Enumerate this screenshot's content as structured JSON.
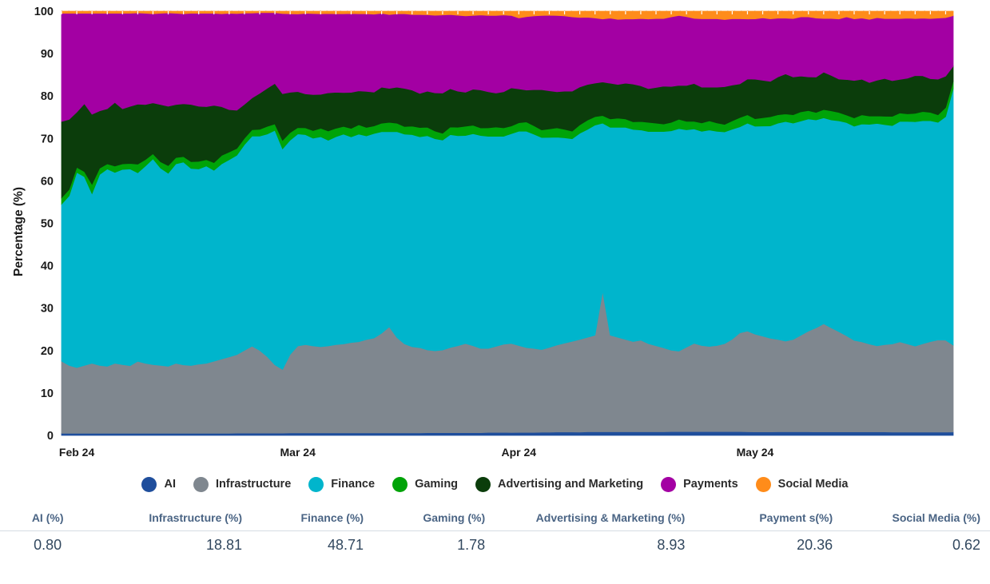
{
  "chart_data": {
    "type": "area",
    "stacked": true,
    "stack_mode": "percent",
    "title": "",
    "xlabel": "",
    "ylabel": "Percentage (%)",
    "ylim": [
      0,
      100
    ],
    "yticks": [
      0,
      10,
      20,
      30,
      40,
      50,
      60,
      70,
      80,
      90,
      100
    ],
    "ytick_labels": [
      "0",
      "10",
      "20",
      "30",
      "40",
      "50",
      "60",
      "70",
      "80",
      "90",
      "100"
    ],
    "grid": true,
    "grid_style": "dotted",
    "legend_position": "bottom",
    "xtick_labels": [
      "Feb 24",
      "Mar 24",
      "Apr 24",
      "May 24"
    ],
    "xtick_positions": [
      2,
      31,
      60,
      91
    ],
    "x_count": 118,
    "series": [
      {
        "name": "AI",
        "color": "#1f4e9c",
        "values": [
          0.5,
          0.5,
          0.5,
          0.5,
          0.5,
          0.5,
          0.5,
          0.5,
          0.5,
          0.5,
          0.5,
          0.5,
          0.5,
          0.5,
          0.5,
          0.5,
          0.5,
          0.5,
          0.5,
          0.5,
          0.5,
          0.5,
          0.5,
          0.55,
          0.55,
          0.55,
          0.55,
          0.55,
          0.55,
          0.55,
          0.6,
          0.6,
          0.6,
          0.6,
          0.6,
          0.6,
          0.6,
          0.6,
          0.6,
          0.6,
          0.6,
          0.6,
          0.6,
          0.6,
          0.6,
          0.6,
          0.6,
          0.6,
          0.65,
          0.65,
          0.65,
          0.65,
          0.65,
          0.65,
          0.65,
          0.65,
          0.7,
          0.7,
          0.7,
          0.7,
          0.7,
          0.7,
          0.7,
          0.75,
          0.75,
          0.8,
          0.8,
          0.8,
          0.8,
          0.85,
          0.85,
          0.85,
          0.85,
          0.85,
          0.85,
          0.85,
          0.85,
          0.85,
          0.85,
          0.85,
          0.9,
          0.9,
          0.9,
          0.9,
          0.9,
          0.9,
          0.9,
          0.9,
          0.9,
          0.9,
          0.85,
          0.85,
          0.85,
          0.85,
          0.85,
          0.85,
          0.85,
          0.85,
          0.85,
          0.85,
          0.85,
          0.85,
          0.85,
          0.85,
          0.85,
          0.85,
          0.85,
          0.85,
          0.85,
          0.8,
          0.8,
          0.8,
          0.8,
          0.8,
          0.8,
          0.8,
          0.8,
          0.8
        ]
      },
      {
        "name": "Infrastructure",
        "color": "#7f878f",
        "values": [
          17.0,
          16.0,
          15.5,
          16.0,
          16.5,
          16.0,
          15.8,
          16.5,
          16.2,
          16.0,
          16.8,
          16.5,
          16.2,
          16.0,
          15.8,
          16.5,
          16.2,
          16.0,
          16.3,
          16.5,
          17.0,
          17.5,
          18.0,
          18.5,
          19.5,
          20.5,
          19.5,
          18.0,
          16.0,
          15.0,
          18.5,
          20.5,
          20.8,
          20.5,
          20.3,
          20.5,
          20.8,
          21.0,
          21.3,
          21.5,
          22.0,
          22.5,
          23.5,
          25.0,
          22.5,
          21.0,
          20.3,
          20.0,
          19.5,
          19.3,
          19.5,
          20.0,
          20.5,
          21.0,
          20.5,
          20.0,
          19.8,
          20.3,
          20.8,
          21.0,
          20.5,
          20.0,
          19.8,
          19.5,
          20.0,
          20.5,
          21.0,
          21.5,
          22.0,
          22.5,
          23.0,
          33.5,
          23.0,
          22.5,
          22.0,
          21.5,
          21.8,
          21.0,
          20.5,
          20.0,
          19.3,
          19.0,
          20.0,
          21.0,
          20.5,
          20.3,
          20.5,
          21.0,
          22.0,
          23.5,
          24.0,
          23.5,
          23.0,
          22.5,
          22.0,
          21.5,
          22.0,
          23.0,
          24.0,
          25.0,
          26.0,
          25.0,
          24.0,
          23.0,
          22.0,
          21.5,
          21.0,
          20.5,
          20.8,
          21.0,
          21.5,
          21.0,
          20.5,
          21.0,
          21.5,
          22.0,
          22.0,
          20.5
        ]
      },
      {
        "name": "Finance",
        "color": "#00b5cc",
        "values": [
          37.0,
          40.0,
          46.0,
          44.5,
          40.0,
          45.0,
          46.5,
          45.0,
          46.0,
          46.5,
          44.0,
          46.5,
          48.5,
          46.5,
          45.5,
          47.0,
          48.0,
          46.5,
          46.0,
          46.5,
          45.0,
          46.0,
          46.5,
          47.0,
          48.5,
          49.5,
          50.5,
          52.5,
          55.0,
          52.0,
          50.5,
          50.0,
          49.5,
          49.0,
          49.5,
          48.5,
          49.0,
          49.5,
          48.5,
          49.0,
          48.0,
          48.5,
          47.5,
          46.0,
          48.5,
          49.5,
          50.0,
          49.5,
          50.5,
          50.0,
          49.5,
          50.0,
          49.5,
          49.0,
          50.0,
          50.5,
          50.0,
          49.5,
          49.0,
          49.5,
          50.5,
          51.0,
          50.5,
          50.0,
          49.5,
          49.0,
          48.5,
          48.0,
          49.0,
          49.5,
          50.0,
          40.0,
          49.5,
          50.0,
          50.5,
          50.5,
          50.0,
          50.5,
          51.0,
          51.5,
          52.0,
          52.5,
          51.5,
          51.0,
          51.0,
          51.5,
          51.0,
          50.5,
          50.0,
          49.0,
          49.5,
          50.0,
          50.5,
          51.0,
          51.5,
          52.0,
          51.5,
          51.0,
          50.5,
          50.0,
          49.5,
          50.0,
          50.5,
          51.0,
          51.5,
          52.0,
          52.5,
          53.0,
          52.5,
          52.0,
          52.5,
          53.0,
          53.5,
          53.0,
          52.5,
          52.0,
          53.5,
          60.5
        ]
      },
      {
        "name": "Gaming",
        "color": "#00a308",
        "values": [
          1.5,
          1.5,
          1.2,
          1.2,
          2.2,
          1.5,
          1.2,
          1.5,
          1.3,
          1.3,
          2.0,
          1.5,
          1.2,
          1.5,
          1.8,
          1.5,
          1.3,
          1.6,
          1.8,
          1.5,
          1.8,
          2.0,
          1.8,
          1.6,
          1.5,
          1.5,
          1.6,
          1.8,
          1.5,
          2.0,
          1.8,
          1.5,
          1.6,
          1.8,
          2.0,
          2.2,
          2.0,
          1.8,
          2.0,
          2.2,
          2.0,
          1.8,
          2.0,
          2.2,
          2.0,
          1.8,
          2.0,
          2.2,
          2.0,
          1.8,
          1.6,
          1.8,
          2.0,
          2.2,
          2.0,
          1.8,
          2.0,
          2.2,
          2.0,
          1.8,
          2.0,
          2.2,
          2.0,
          1.8,
          2.0,
          2.2,
          2.0,
          1.8,
          2.0,
          2.2,
          2.0,
          1.8,
          2.0,
          2.2,
          2.0,
          1.8,
          2.0,
          2.2,
          2.0,
          1.8,
          2.0,
          2.2,
          2.0,
          1.8,
          2.0,
          2.2,
          2.0,
          1.8,
          2.0,
          2.2,
          2.0,
          1.8,
          2.0,
          2.2,
          2.0,
          1.8,
          2.0,
          2.2,
          2.0,
          1.8,
          2.0,
          2.2,
          2.0,
          1.8,
          2.0,
          2.2,
          2.0,
          1.8,
          2.0,
          2.2,
          2.0,
          1.8,
          2.0,
          2.2,
          2.0,
          1.8,
          2.2,
          1.8
        ]
      },
      {
        "name": "Advertising and Marketing",
        "color": "#0b3d0b",
        "values": [
          18.0,
          16.5,
          13.0,
          16.0,
          16.5,
          13.5,
          13.0,
          15.0,
          13.0,
          13.5,
          14.0,
          13.0,
          12.0,
          13.5,
          14.0,
          12.5,
          12.5,
          13.5,
          13.0,
          12.5,
          13.5,
          11.5,
          10.0,
          9.0,
          8.0,
          7.5,
          8.5,
          9.0,
          9.5,
          11.0,
          9.5,
          8.5,
          8.0,
          8.5,
          8.0,
          9.0,
          8.5,
          8.0,
          8.5,
          8.0,
          8.5,
          8.0,
          8.5,
          8.0,
          8.5,
          9.0,
          8.5,
          8.0,
          8.5,
          9.0,
          9.5,
          9.0,
          8.5,
          8.0,
          8.5,
          9.0,
          8.5,
          8.0,
          8.5,
          9.0,
          8.0,
          7.5,
          8.5,
          9.5,
          9.0,
          8.5,
          9.0,
          9.5,
          9.0,
          8.5,
          8.0,
          8.0,
          8.5,
          8.0,
          8.5,
          9.0,
          8.5,
          8.0,
          8.5,
          9.0,
          8.5,
          8.0,
          8.5,
          9.0,
          8.5,
          8.0,
          8.5,
          9.0,
          8.5,
          8.0,
          8.5,
          9.5,
          9.0,
          8.5,
          9.0,
          9.5,
          9.0,
          8.5,
          8.0,
          8.5,
          9.0,
          8.5,
          8.0,
          8.5,
          9.0,
          8.5,
          8.0,
          8.5,
          9.0,
          8.5,
          8.0,
          8.5,
          9.0,
          8.5,
          8.0,
          8.5,
          7.5,
          3.5
        ]
      },
      {
        "name": "Payments",
        "color": "#a300a3",
        "values": [
          25.5,
          25.0,
          23.3,
          21.3,
          23.8,
          23.0,
          22.5,
          21.0,
          22.5,
          22.0,
          21.3,
          21.5,
          21.0,
          21.5,
          22.0,
          21.5,
          21.3,
          21.5,
          21.9,
          22.0,
          21.7,
          21.9,
          22.7,
          22.8,
          21.5,
          20.0,
          19.0,
          17.8,
          16.6,
          18.9,
          18.5,
          18.3,
          19.0,
          19.1,
          19.0,
          18.7,
          18.5,
          18.6,
          18.6,
          18.2,
          18.3,
          18.5,
          17.4,
          17.4,
          17.3,
          17.6,
          17.8,
          18.5,
          18.0,
          18.3,
          18.4,
          17.4,
          17.9,
          18.0,
          17.4,
          17.8,
          18.0,
          18.3,
          18.1,
          17.1,
          16.7,
          17.3,
          17.4,
          17.5,
          17.8,
          18.0,
          17.8,
          17.6,
          16.5,
          16.0,
          15.5,
          15.0,
          15.5,
          15.5,
          15.3,
          15.5,
          16.0,
          16.6,
          16.4,
          16.1,
          16.5,
          16.5,
          16.3,
          15.5,
          16.3,
          16.3,
          16.3,
          16.0,
          15.8,
          15.5,
          14.3,
          14.5,
          15.0,
          15.0,
          14.0,
          13.2,
          13.9,
          14.1,
          14.3,
          14.2,
          12.9,
          13.7,
          14.4,
          15.0,
          14.8,
          14.6,
          15.1,
          14.9,
          14.3,
          14.8,
          14.5,
          14.3,
          13.6,
          13.7,
          14.3,
          14.6,
          14.0,
          11.9
        ]
      },
      {
        "name": "Social Media",
        "color": "#ff8c1a",
        "values": [
          0.5,
          0.5,
          0.5,
          0.5,
          0.5,
          0.5,
          0.5,
          0.5,
          0.5,
          0.5,
          0.4,
          0.5,
          0.6,
          0.5,
          0.4,
          0.5,
          0.6,
          0.5,
          0.5,
          0.5,
          0.5,
          0.6,
          0.5,
          0.55,
          0.45,
          0.45,
          0.35,
          0.35,
          0.35,
          0.55,
          0.6,
          0.65,
          0.5,
          0.55,
          0.6,
          0.55,
          0.6,
          0.6,
          0.55,
          0.6,
          0.6,
          0.7,
          0.5,
          0.8,
          0.6,
          0.6,
          0.8,
          0.8,
          0.85,
          0.95,
          0.9,
          0.8,
          0.95,
          1.1,
          1.0,
          0.9,
          1.0,
          1.0,
          0.9,
          1.0,
          1.6,
          1.3,
          1.1,
          1.0,
          0.95,
          1.0,
          1.1,
          1.35,
          1.5,
          1.45,
          1.6,
          1.85,
          1.65,
          1.95,
          1.85,
          1.85,
          1.75,
          1.85,
          1.75,
          1.75,
          1.35,
          1.0,
          1.3,
          1.7,
          1.8,
          1.8,
          1.8,
          2.0,
          1.8,
          1.8,
          1.85,
          1.85,
          1.6,
          1.85,
          1.65,
          1.65,
          1.75,
          1.35,
          1.35,
          1.65,
          1.75,
          1.75,
          1.85,
          1.35,
          1.85,
          1.65,
          1.95,
          1.55,
          1.75,
          1.75,
          1.75,
          1.65,
          1.75,
          1.65,
          1.75,
          1.65,
          1.55,
          1.05
        ]
      }
    ]
  },
  "axis": {
    "y_title": "Percentage (%)",
    "y_ticks": [
      "100",
      "90",
      "80",
      "70",
      "60",
      "50",
      "40",
      "30",
      "20",
      "10",
      "0"
    ],
    "x_ticks": [
      "Feb 24",
      "Mar 24",
      "Apr 24",
      "May 24"
    ]
  },
  "legend": {
    "items": [
      {
        "label": "AI",
        "color": "#1f4e9c"
      },
      {
        "label": "Infrastructure",
        "color": "#7f878f"
      },
      {
        "label": "Finance",
        "color": "#00b5cc"
      },
      {
        "label": "Gaming",
        "color": "#00a308"
      },
      {
        "label": "Advertising and Marketing",
        "color": "#0b3d0b"
      },
      {
        "label": "Payments",
        "color": "#a300a3"
      },
      {
        "label": "Social Media",
        "color": "#ff8c1a"
      }
    ]
  },
  "summary_table": {
    "headers": [
      "AI (%)",
      "Infrastructure (%)",
      "Finance (%)",
      "Gaming (%)",
      "Advertising & Marketing (%)",
      "Payment s(%)",
      "Social Media (%)"
    ],
    "values": [
      "0.80",
      "18.81",
      "48.71",
      "1.78",
      "8.93",
      "20.36",
      "0.62"
    ]
  }
}
